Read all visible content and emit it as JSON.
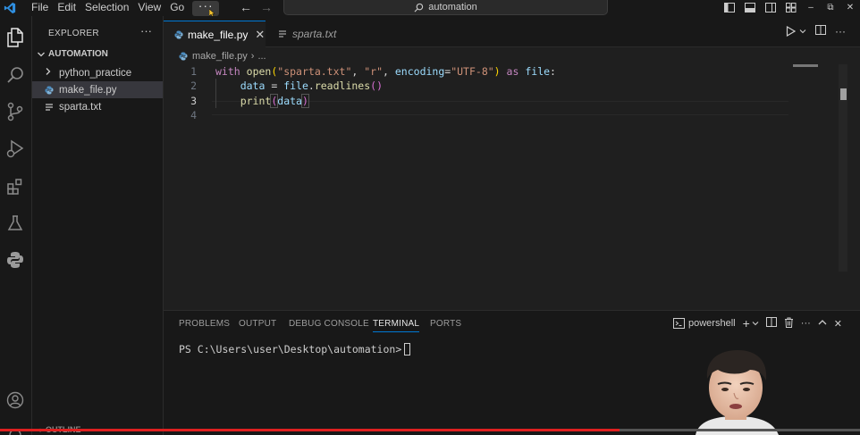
{
  "menu": {
    "items": [
      "File",
      "Edit",
      "Selection",
      "View",
      "Go"
    ],
    "more": "···"
  },
  "command_center": {
    "text": "automation"
  },
  "sidebar": {
    "header": "EXPLORER",
    "more": "···",
    "section": "AUTOMATION",
    "items": [
      {
        "label": "python_practice",
        "type": "folder"
      },
      {
        "label": "make_file.py",
        "type": "python"
      },
      {
        "label": "sparta.txt",
        "type": "text"
      }
    ],
    "outline": "OUTLINE"
  },
  "tabs": [
    {
      "label": "make_file.py",
      "active": true
    },
    {
      "label": "sparta.txt",
      "active": false
    }
  ],
  "breadcrumb": {
    "file": "make_file.py",
    "rest": "..."
  },
  "editor": {
    "line_numbers": [
      "1",
      "2",
      "3",
      "4"
    ],
    "current_line": 3,
    "code": {
      "l1_with": "with",
      "l1_open": "open",
      "l1_arg1": "\"sparta.txt\"",
      "l1_arg2": "\"r\"",
      "l1_kw": "encoding",
      "l1_arg3": "\"UTF-8\"",
      "l1_as": "as",
      "l1_file": "file",
      "l2_data": "data",
      "l2_file": "file",
      "l2_method": "readlines",
      "l3_print": "print",
      "l3_data": "data"
    }
  },
  "panel": {
    "tabs": [
      "PROBLEMS",
      "OUTPUT",
      "DEBUG CONSOLE",
      "TERMINAL",
      "PORTS"
    ],
    "active_tab": "TERMINAL",
    "shell": "powershell",
    "prompt": "PS C:\\Users\\user\\Desktop\\automation>"
  },
  "video": {
    "progress": 0.72
  },
  "colors": {
    "accent": "#0078d4",
    "keyword": "#c586c0",
    "function": "#dcdcaa",
    "string": "#ce9178",
    "variable": "#9cdcfe",
    "progress": "#e02020"
  }
}
